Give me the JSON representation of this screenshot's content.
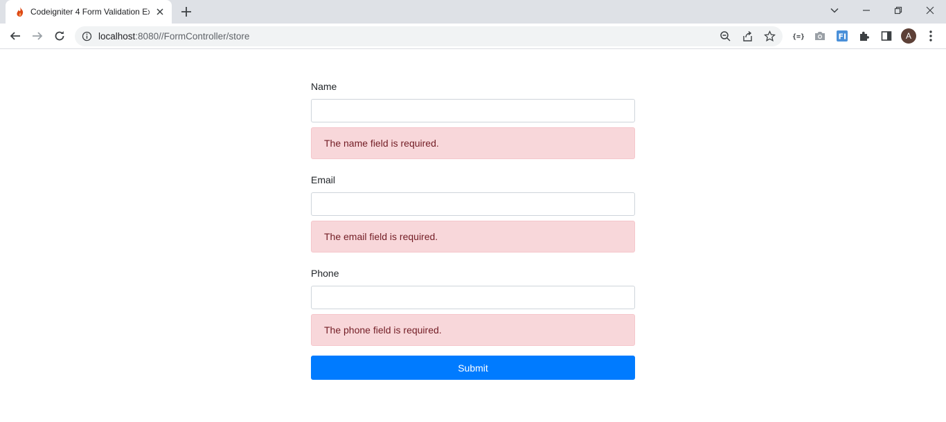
{
  "browser": {
    "tab_title": "Codeigniter 4 Form Validation Ex",
    "url_host": "localhost",
    "url_rest": ":8080//FormController/store",
    "profile_initial": "A",
    "colors": {
      "tabstrip": "#dee1e6",
      "avatar": "#5d4037",
      "ext_blue": "#4a90d9"
    },
    "icons": [
      "flame-favicon-icon",
      "close-icon",
      "plus-icon",
      "chevron-down-icon",
      "minimize-icon",
      "restore-icon",
      "window-close-icon",
      "back-icon",
      "forward-icon",
      "reload-icon",
      "info-icon",
      "zoom-icon",
      "share-icon",
      "star-icon",
      "json-viewer-icon",
      "camera-icon",
      "fi-extension-icon",
      "puzzle-icon",
      "side-panel-icon",
      "kebab-menu-icon"
    ]
  },
  "form": {
    "name_label": "Name",
    "name_error": "The name field is required.",
    "email_label": "Email",
    "email_error": "The email field is required.",
    "phone_label": "Phone",
    "phone_error": "The phone field is required.",
    "submit_label": "Submit",
    "colors": {
      "submit": "#007bff",
      "alert_bg": "#f8d7da",
      "alert_text": "#721c24"
    }
  }
}
